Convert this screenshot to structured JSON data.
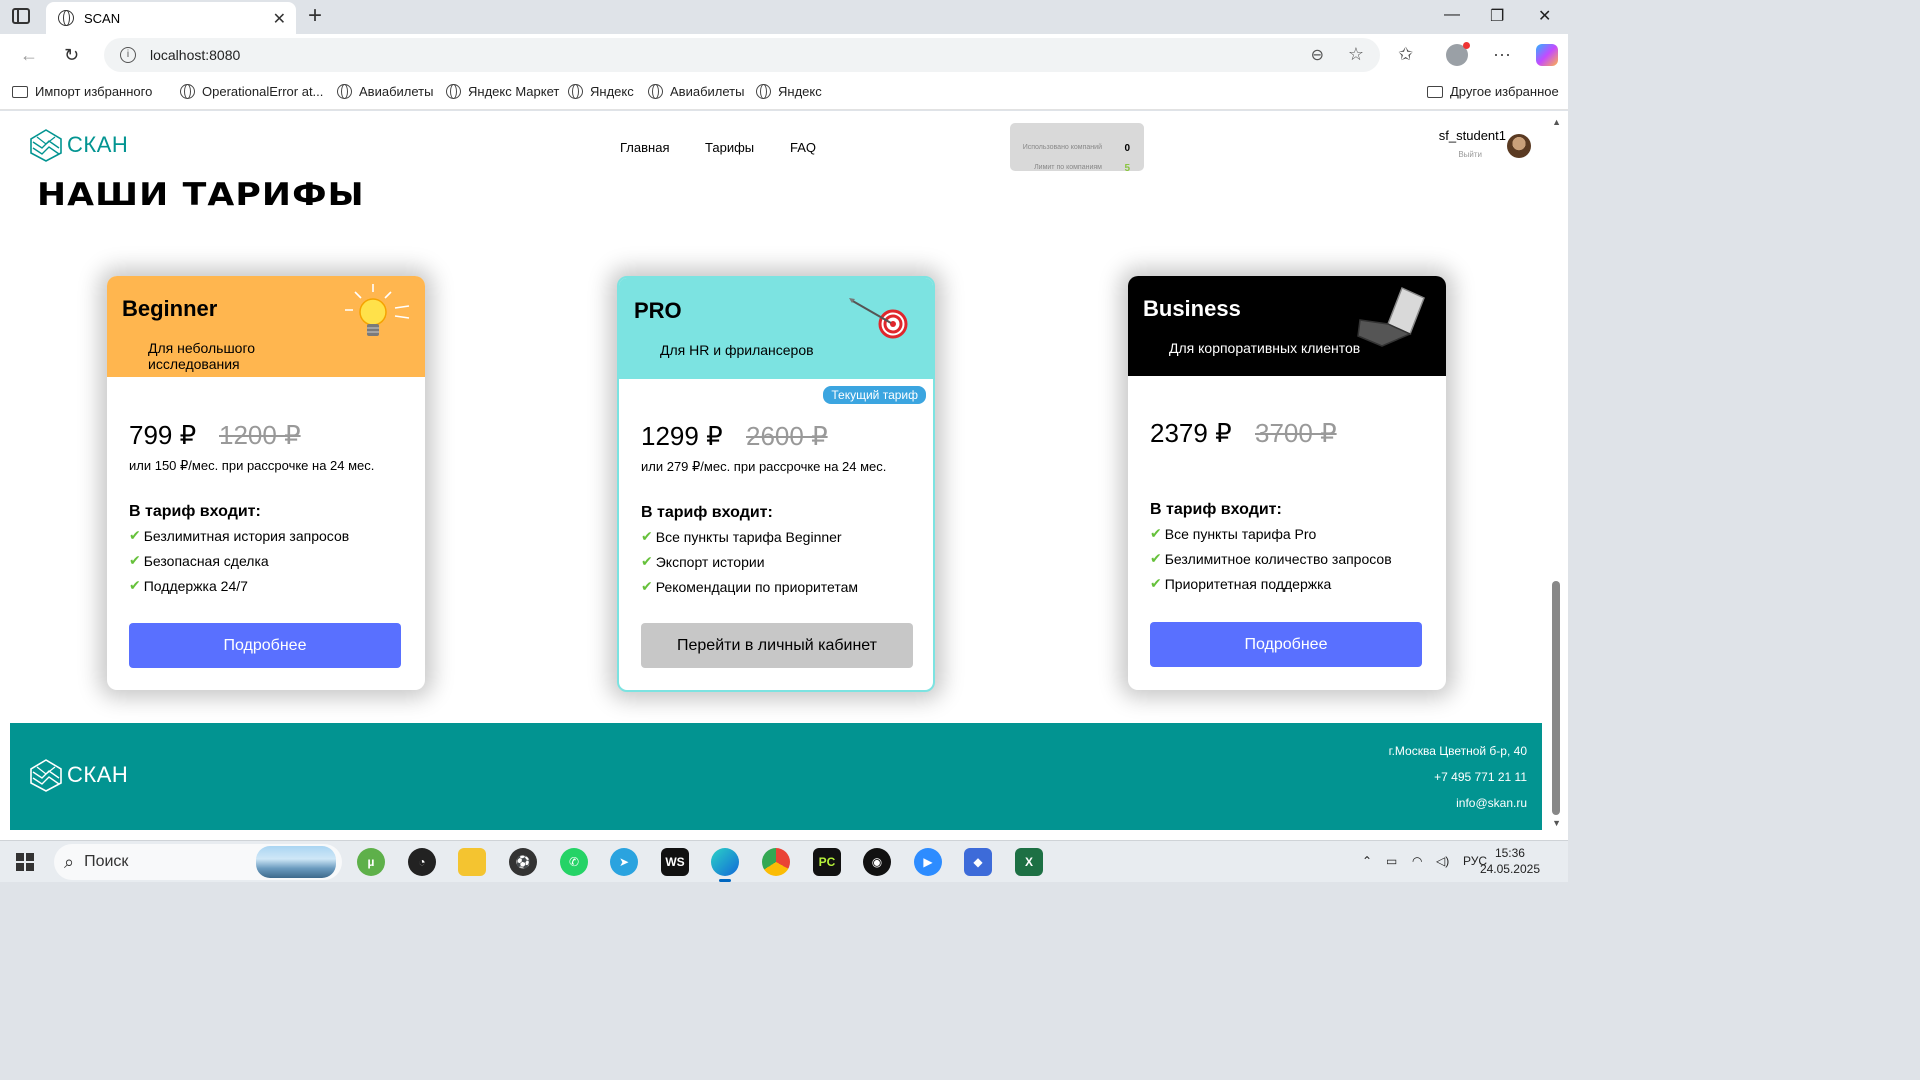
{
  "browser": {
    "tab_title": "SCAN",
    "url": "localhost:8080",
    "bookmarks": [
      "Импорт избранного",
      "OperationalError at...",
      "Авиабилеты",
      "Яндекс Маркет",
      "Яндекс",
      "Авиабилеты",
      "Яндекс"
    ],
    "other_bookmarks": "Другое избранное"
  },
  "header": {
    "logo": "СКАН",
    "nav": [
      "Главная",
      "Тарифы",
      "FAQ"
    ],
    "limits": {
      "used_label": "Использовано компаний",
      "used_value": "0",
      "limit_label": "Лимит по компаниям",
      "limit_value": "5"
    },
    "user": {
      "name": "sf_student1",
      "logout": "Выйти"
    }
  },
  "main": {
    "title": "НАШИ ТАРИФЫ",
    "included_label": "В тариф входит:",
    "plans": [
      {
        "name": "Beginner",
        "subtitle": "Для небольшого исследования",
        "price": "799 ₽",
        "old_price": "1200 ₽",
        "installment": "или 150 ₽/мес. при рассрочке на 24 мес.",
        "features": [
          "Безлимитная история запросов",
          "Безопасная сделка",
          "Поддержка 24/7"
        ],
        "button": "Подробнее",
        "header_color": "#ffb64f",
        "icon": "lightbulb-icon"
      },
      {
        "name": "PRO",
        "subtitle": "Для HR и фрилансеров",
        "badge": "Текущий тариф",
        "price": "1299 ₽",
        "old_price": "2600 ₽",
        "installment": "или 279 ₽/мес. при рассрочке на 24 мес.",
        "features": [
          "Все пункты тарифа Beginner",
          "Экспорт истории",
          "Рекомендации по приоритетам"
        ],
        "button": "Перейти в личный кабинет",
        "header_color": "#7ce3e1",
        "icon": "target-icon"
      },
      {
        "name": "Business",
        "subtitle": "Для корпоративных клиентов",
        "price": "2379 ₽",
        "old_price": "3700 ₽",
        "features": [
          "Все пункты тарифа Pro",
          "Безлимитное количество запросов",
          "Приоритетная поддержка"
        ],
        "button": "Подробнее",
        "header_color": "#000000",
        "icon": "laptop-icon"
      }
    ]
  },
  "footer": {
    "logo": "СКАН",
    "address": "г.Москва Цветной б-р, 40",
    "phone": "+7 495 771 21 11",
    "email": "info@skan.ru",
    "background": "#029491"
  },
  "taskbar": {
    "search_placeholder": "Поиск",
    "language": "РУС",
    "time": "15:36",
    "date": "24.05.2025"
  }
}
